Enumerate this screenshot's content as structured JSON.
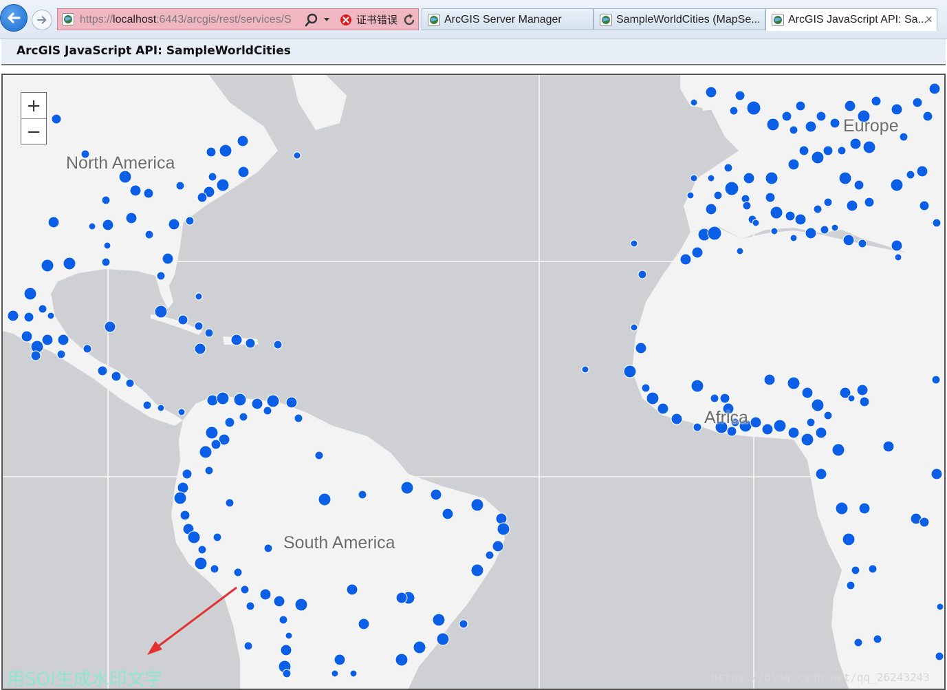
{
  "browser": {
    "address": {
      "scheme_prefix": "https://",
      "host": "localhost",
      "rest": ":6443/arcgis/rest/services/S"
    },
    "cert_error_label": "证书错误",
    "tabs": [
      {
        "label": "ArcGIS Server Manager",
        "active": false
      },
      {
        "label": "SampleWorldCities (MapSe...",
        "active": false
      },
      {
        "label": "ArcGIS JavaScript API: Sa...",
        "active": true,
        "close": "×"
      }
    ]
  },
  "page": {
    "title": "ArcGIS JavaScript API: SampleWorldCities"
  },
  "map": {
    "zoom_in_label": "+",
    "zoom_out_label": "−",
    "continent_labels": {
      "north_america": "North America",
      "europe": "Europe",
      "africa": "Africa",
      "south_america": "South America"
    },
    "city_symbol_color": "#0b5fe6",
    "land_color": "#f3f3f3",
    "ocean_color": "#cfd0d3",
    "annotation_arrow_color": "#e53030",
    "watermark_text": "用SOI生成水印文字",
    "credit_text": "https://blog.csdn.net/qq_26243243"
  }
}
